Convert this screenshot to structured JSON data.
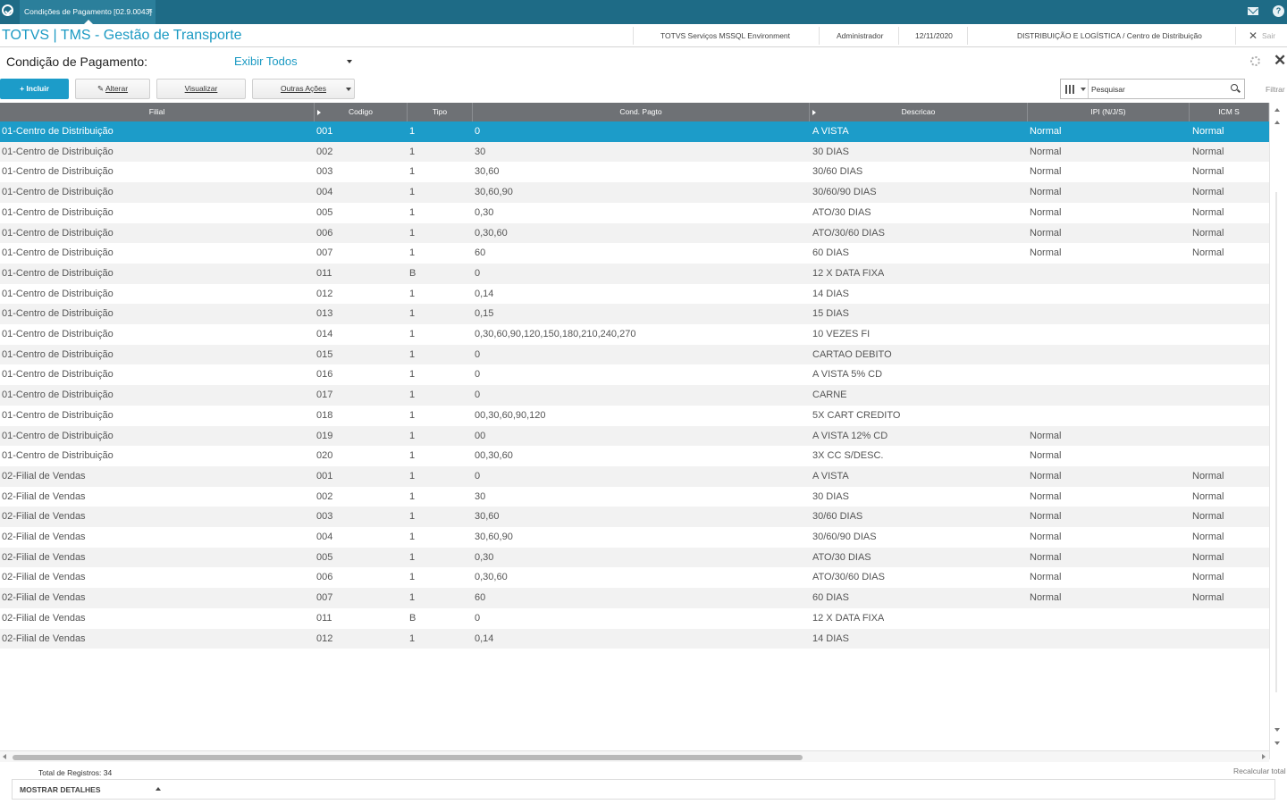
{
  "topbar": {
    "tab_title": "Condições de Pagamento [02.9.0043]",
    "tab_close": "×"
  },
  "infobar": {
    "app_title": "TOTVS | TMS - Gestão de Transporte",
    "environment": "TOTVS Serviços MSSQL Environment",
    "user": "Administrador",
    "date": "12/11/2020",
    "branch": "DISTRIBUIÇÃO E LOGÍSTICA / Centro de Distribuição",
    "exit_label": "Sair"
  },
  "page": {
    "title": "Condição de Pagamento:",
    "view_selected": "Exibir Todos"
  },
  "toolbar": {
    "include_label": "+ Incluir",
    "edit_label": "Alterar",
    "view_label": "Visualizar",
    "other_actions_label": "Outras Ações"
  },
  "search": {
    "placeholder": "Pesquisar",
    "filter_label": "Filtrar"
  },
  "grid": {
    "columns": [
      "Filial",
      "Codigo",
      "Tipo",
      "Cond. Pagto",
      "Descricao",
      "IPI (N/J/S)",
      "ICM S"
    ],
    "rows": [
      [
        "01-Centro de Distribuição",
        "001",
        "1",
        "0",
        "A VISTA",
        "Normal",
        "Normal"
      ],
      [
        "01-Centro de Distribuição",
        "002",
        "1",
        "30",
        "30 DIAS",
        "Normal",
        "Normal"
      ],
      [
        "01-Centro de Distribuição",
        "003",
        "1",
        "30,60",
        "30/60 DIAS",
        "Normal",
        "Normal"
      ],
      [
        "01-Centro de Distribuição",
        "004",
        "1",
        "30,60,90",
        "30/60/90 DIAS",
        "Normal",
        "Normal"
      ],
      [
        "01-Centro de Distribuição",
        "005",
        "1",
        "0,30",
        "ATO/30 DIAS",
        "Normal",
        "Normal"
      ],
      [
        "01-Centro de Distribuição",
        "006",
        "1",
        "0,30,60",
        "ATO/30/60 DIAS",
        "Normal",
        "Normal"
      ],
      [
        "01-Centro de Distribuição",
        "007",
        "1",
        "60",
        "60 DIAS",
        "Normal",
        "Normal"
      ],
      [
        "01-Centro de Distribuição",
        "011",
        "B",
        "0",
        "12 X DATA FIXA",
        "",
        ""
      ],
      [
        "01-Centro de Distribuição",
        "012",
        "1",
        "0,14",
        "14 DIAS",
        "",
        ""
      ],
      [
        "01-Centro de Distribuição",
        "013",
        "1",
        "0,15",
        "15 DIAS",
        "",
        ""
      ],
      [
        "01-Centro de Distribuição",
        "014",
        "1",
        "0,30,60,90,120,150,180,210,240,270",
        "10 VEZES FI",
        "",
        ""
      ],
      [
        "01-Centro de Distribuição",
        "015",
        "1",
        "0",
        "CARTAO DEBITO",
        "",
        ""
      ],
      [
        "01-Centro de Distribuição",
        "016",
        "1",
        "0",
        "A VISTA 5% CD",
        "",
        ""
      ],
      [
        "01-Centro de Distribuição",
        "017",
        "1",
        "0",
        "CARNE",
        "",
        ""
      ],
      [
        "01-Centro de Distribuição",
        "018",
        "1",
        "00,30,60,90,120",
        "5X CART CREDITO",
        "",
        ""
      ],
      [
        "01-Centro de Distribuição",
        "019",
        "1",
        "00",
        "A VISTA 12% CD",
        "Normal",
        ""
      ],
      [
        "01-Centro de Distribuição",
        "020",
        "1",
        "00,30,60",
        "3X CC S/DESC.",
        "Normal",
        ""
      ],
      [
        "02-Filial de Vendas",
        "001",
        "1",
        "0",
        "A VISTA",
        "Normal",
        "Normal"
      ],
      [
        "02-Filial de Vendas",
        "002",
        "1",
        "30",
        "30 DIAS",
        "Normal",
        "Normal"
      ],
      [
        "02-Filial de Vendas",
        "003",
        "1",
        "30,60",
        "30/60 DIAS",
        "Normal",
        "Normal"
      ],
      [
        "02-Filial de Vendas",
        "004",
        "1",
        "30,60,90",
        "30/60/90 DIAS",
        "Normal",
        "Normal"
      ],
      [
        "02-Filial de Vendas",
        "005",
        "1",
        "0,30",
        "ATO/30 DIAS",
        "Normal",
        "Normal"
      ],
      [
        "02-Filial de Vendas",
        "006",
        "1",
        "0,30,60",
        "ATO/30/60 DIAS",
        "Normal",
        "Normal"
      ],
      [
        "02-Filial de Vendas",
        "007",
        "1",
        "60",
        "60 DIAS",
        "Normal",
        "Normal"
      ],
      [
        "02-Filial de Vendas",
        "011",
        "B",
        "0",
        "12 X DATA FIXA",
        "",
        ""
      ],
      [
        "02-Filial de Vendas",
        "012",
        "1",
        "0,14",
        "14 DIAS",
        "",
        ""
      ]
    ],
    "selected_row": 0
  },
  "footer": {
    "total_label": "Total de Registros: 34",
    "recalc_label": "Recalcular total",
    "details_label": "MOSTRAR DETALHES"
  },
  "colors": {
    "topbar": "#1e6b86",
    "accent": "#1c9cc9",
    "header": "#6e7175"
  }
}
